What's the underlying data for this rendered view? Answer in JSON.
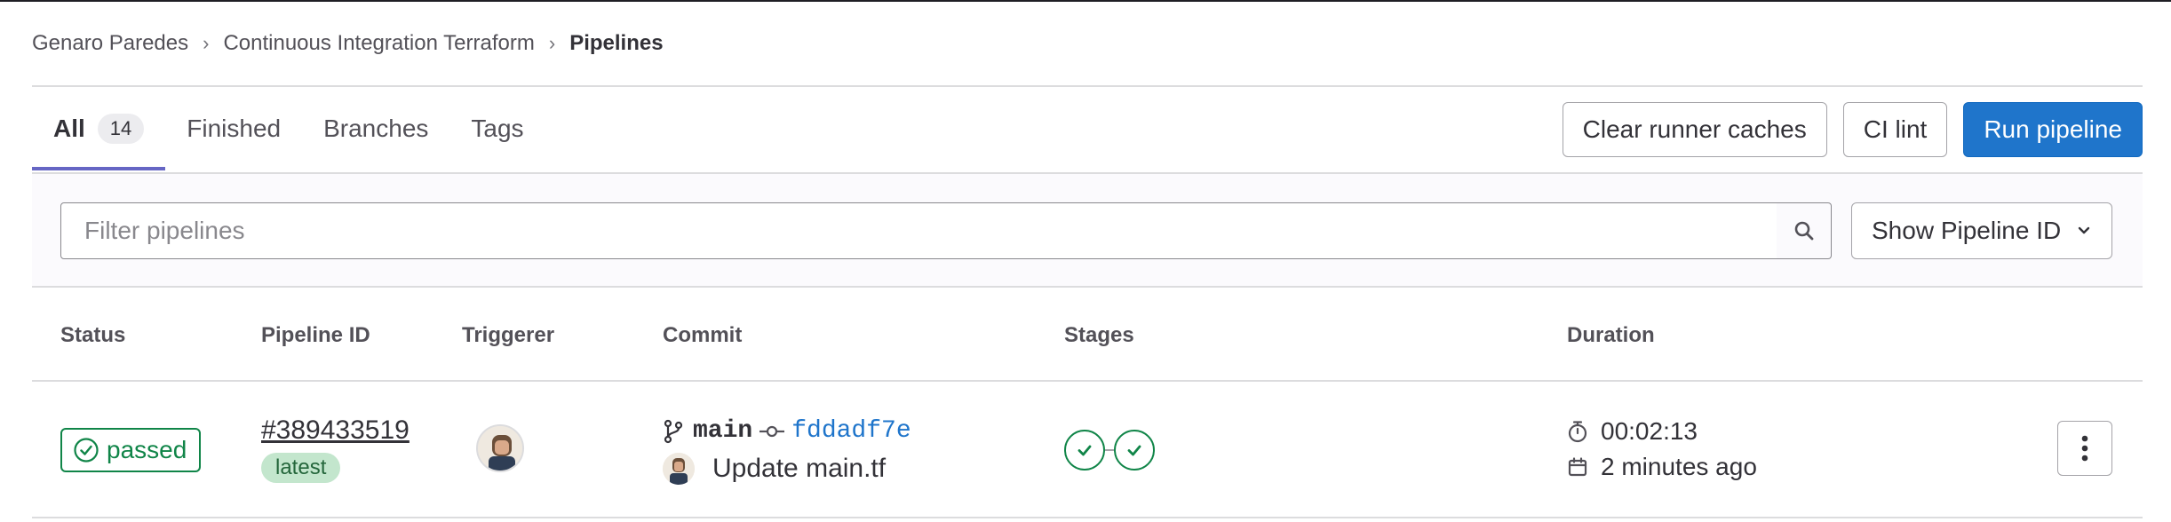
{
  "breadcrumb": {
    "items": [
      "Genaro Paredes",
      "Continuous Integration Terraform"
    ],
    "current": "Pipelines"
  },
  "tabs": [
    {
      "label": "All",
      "count": "14",
      "active": true
    },
    {
      "label": "Finished"
    },
    {
      "label": "Branches"
    },
    {
      "label": "Tags"
    }
  ],
  "actions": {
    "clear_caches": "Clear runner caches",
    "ci_lint": "CI lint",
    "run_pipeline": "Run pipeline"
  },
  "filter": {
    "placeholder": "Filter pipelines",
    "show_select": "Show Pipeline ID"
  },
  "table": {
    "headers": {
      "status": "Status",
      "pipeline_id": "Pipeline ID",
      "triggerer": "Triggerer",
      "commit": "Commit",
      "stages": "Stages",
      "duration": "Duration"
    },
    "rows": [
      {
        "status": "passed",
        "pipeline_id": "#389433519",
        "badge": "latest",
        "branch": "main",
        "sha": "fddadf7e",
        "message": "Update main.tf",
        "stages": [
          "passed",
          "passed"
        ],
        "duration": "00:02:13",
        "finished": "2 minutes ago"
      }
    ]
  },
  "colors": {
    "primary": "#1f75cb",
    "success": "#108548",
    "tab_active": "#6666c4"
  }
}
